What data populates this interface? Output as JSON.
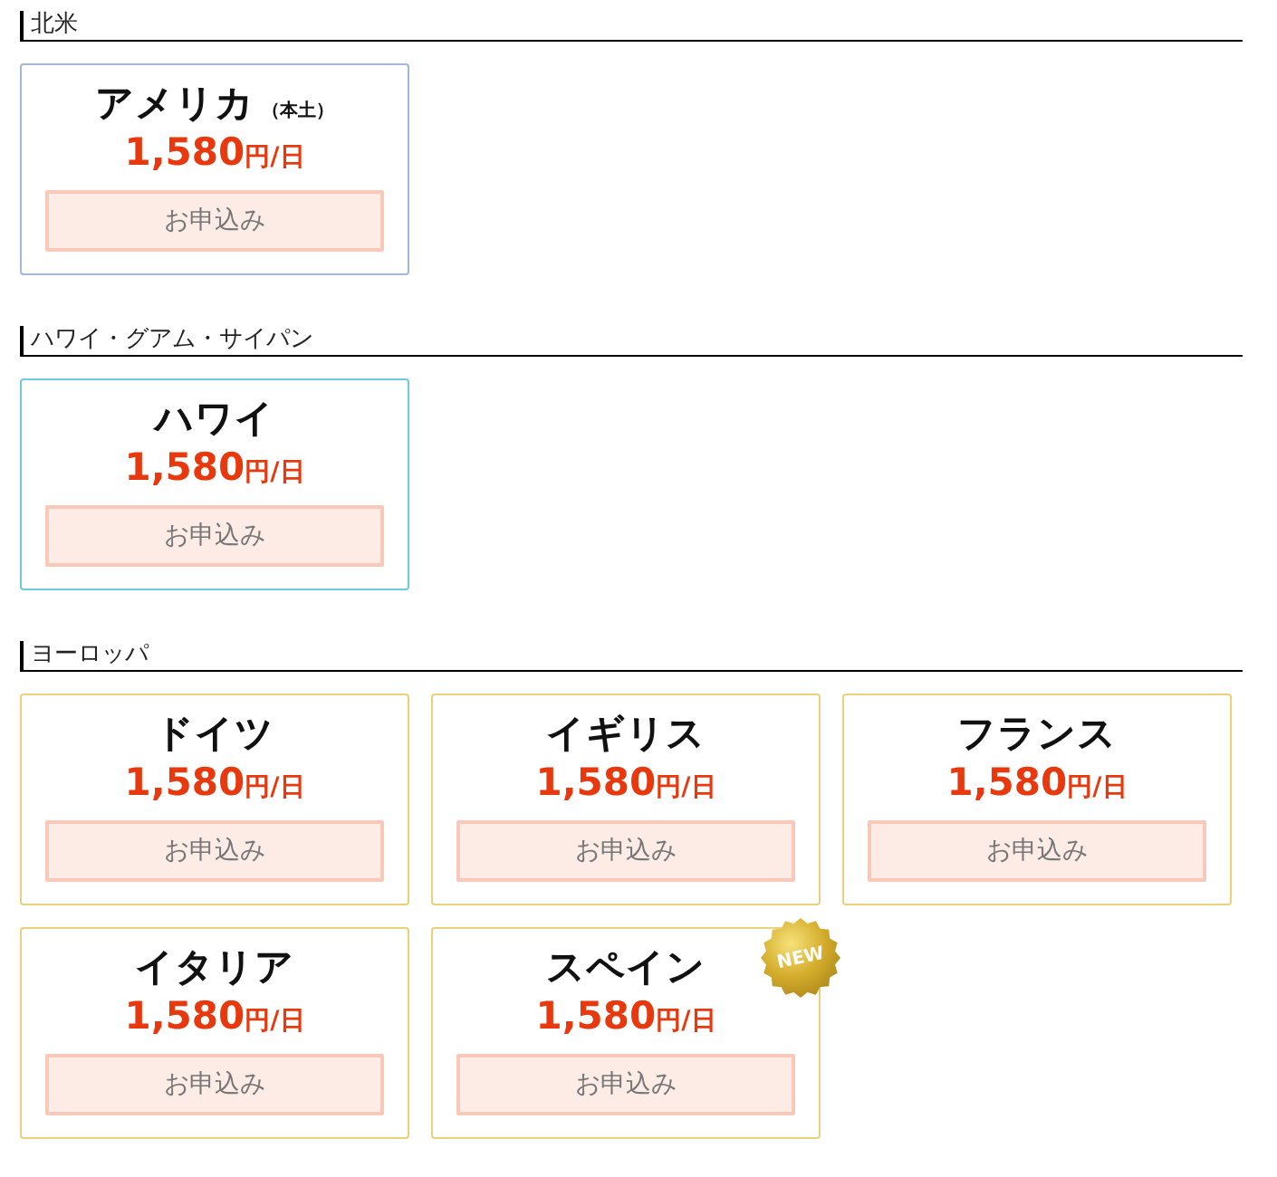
{
  "sections": [
    {
      "title": "北米",
      "color": "#a3b6dc",
      "plans": [
        {
          "name": "アメリカ",
          "note": "（本土）",
          "price": "1,580",
          "unit": "円/日",
          "button": "お申込み"
        }
      ]
    },
    {
      "title": "ハワイ・グアム・サイパン",
      "color": "#6ccbdd",
      "plans": [
        {
          "name": "ハワイ",
          "price": "1,580",
          "unit": "円/日",
          "button": "お申込み"
        }
      ]
    },
    {
      "title": "ヨーロッパ",
      "color": "#ead17a",
      "plans": [
        {
          "name": "ドイツ",
          "price": "1,580",
          "unit": "円/日",
          "button": "お申込み"
        },
        {
          "name": "イギリス",
          "price": "1,580",
          "unit": "円/日",
          "button": "お申込み"
        },
        {
          "name": "フランス",
          "price": "1,580",
          "unit": "円/日",
          "button": "お申込み"
        },
        {
          "name": "イタリア",
          "price": "1,580",
          "unit": "円/日",
          "button": "お申込み"
        },
        {
          "name": "スペイン",
          "badge": "NEW",
          "price": "1,580",
          "unit": "円/日",
          "button": "お申込み"
        }
      ]
    }
  ]
}
